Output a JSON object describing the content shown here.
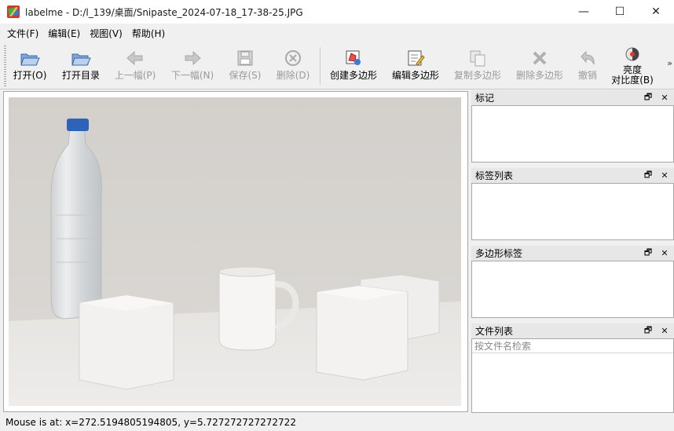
{
  "window": {
    "title": "labelme - D:/l_139/桌面/Snipaste_2024-07-18_17-38-25.JPG",
    "controls": {
      "minimize": "—",
      "maximize": "☐",
      "close": "✕"
    },
    "icon": "labelme-app-icon"
  },
  "menu": {
    "items": [
      "文件(F)",
      "编辑(E)",
      "视图(V)",
      "帮助(H)"
    ]
  },
  "toolbar": {
    "items": [
      {
        "label": "打开(O)",
        "icon": "open-folder-icon",
        "enabled": true
      },
      {
        "label": "打开目录",
        "icon": "open-directory-icon",
        "enabled": true
      },
      {
        "label": "上一幅(P)",
        "icon": "prev-arrow-icon",
        "enabled": false
      },
      {
        "label": "下一幅(N)",
        "icon": "next-arrow-icon",
        "enabled": false
      },
      {
        "label": "保存(S)",
        "icon": "save-icon",
        "enabled": false
      },
      {
        "label": "删除(D)",
        "icon": "delete-icon",
        "enabled": false
      },
      {
        "label": "创建多边形",
        "icon": "create-polygon-icon",
        "enabled": true
      },
      {
        "label": "编辑多边形",
        "icon": "edit-polygon-icon",
        "enabled": true
      },
      {
        "label": "复制多边形",
        "icon": "copy-polygon-icon",
        "enabled": false
      },
      {
        "label": "删除多边形",
        "icon": "delete-polygon-icon",
        "enabled": false
      },
      {
        "label": "撤销",
        "icon": "undo-icon",
        "enabled": false
      },
      {
        "label_line1": "亮度",
        "label_line2": "对比度(B)",
        "icon": "brightness-contrast-icon",
        "enabled": true
      }
    ],
    "overflow": "»"
  },
  "docks": {
    "flags": {
      "title": "标记"
    },
    "label_list": {
      "title": "标签列表"
    },
    "polygon_labels": {
      "title": "多边形标签"
    },
    "file_list": {
      "title": "文件列表",
      "search_placeholder": "按文件名检索"
    },
    "float_glyph": "🗗",
    "close_glyph": "✕"
  },
  "status": {
    "text": "Mouse is at: x=272.5194805194805, y=5.727272727272722"
  },
  "colors": {
    "background": "#f0f0f0",
    "photo_wall": "#d6d3cf",
    "bottle_cap": "#2f63b8"
  }
}
